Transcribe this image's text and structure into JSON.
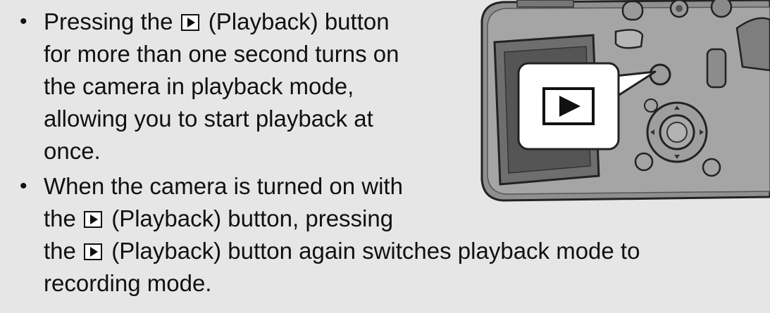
{
  "bullets": [
    {
      "marker": "•",
      "lines": [
        {
          "before": "Pressing the ",
          "icon": true,
          "after": " (Playback) button"
        },
        {
          "text": "for more than one second turns on"
        },
        {
          "text": "the camera in playback mode,"
        },
        {
          "text": "allowing you to start playback at"
        },
        {
          "text": "once."
        }
      ]
    },
    {
      "marker": "•",
      "lines": [
        {
          "text": "When the camera is turned on with"
        },
        {
          "before": "the ",
          "icon": true,
          "after": " (Playback) button, pressing"
        },
        {
          "before": "the ",
          "icon": true,
          "after": " (Playback) button again switches playback mode to"
        },
        {
          "text": "recording mode."
        }
      ]
    }
  ],
  "illustration": {
    "name": "camera-back-illustration",
    "callout_icon": "playback-icon"
  }
}
